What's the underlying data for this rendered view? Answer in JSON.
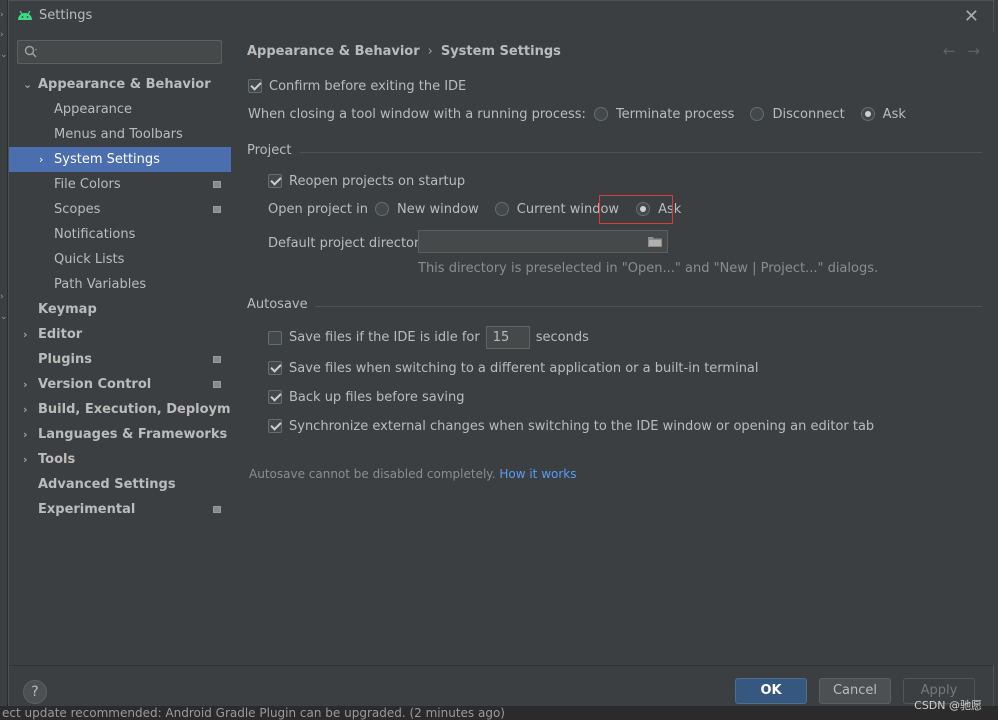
{
  "window": {
    "title": "Settings",
    "close_glyph": "✕"
  },
  "colors": {
    "selection": "#4b6eaf",
    "ok_button": "#365880",
    "link": "#589df6",
    "highlight_box": "#d83b3b"
  },
  "search": {
    "placeholder": "",
    "value": ""
  },
  "sidebar": {
    "items": [
      {
        "label": "Appearance & Behavior",
        "bold": true,
        "arrow": "⌄",
        "level": 0
      },
      {
        "label": "Appearance",
        "bold": false,
        "arrow": "",
        "level": 1
      },
      {
        "label": "Menus and Toolbars",
        "bold": false,
        "arrow": "",
        "level": 1
      },
      {
        "label": "System Settings",
        "bold": false,
        "arrow": "›",
        "level": 1,
        "selected": true
      },
      {
        "label": "File Colors",
        "bold": false,
        "arrow": "",
        "level": 1,
        "project_icon": true
      },
      {
        "label": "Scopes",
        "bold": false,
        "arrow": "",
        "level": 1,
        "project_icon": true
      },
      {
        "label": "Notifications",
        "bold": false,
        "arrow": "",
        "level": 1
      },
      {
        "label": "Quick Lists",
        "bold": false,
        "arrow": "",
        "level": 1
      },
      {
        "label": "Path Variables",
        "bold": false,
        "arrow": "",
        "level": 1
      },
      {
        "label": "Keymap",
        "bold": true,
        "arrow": "",
        "level": 0
      },
      {
        "label": "Editor",
        "bold": true,
        "arrow": "›",
        "level": 0
      },
      {
        "label": "Plugins",
        "bold": true,
        "arrow": "",
        "level": 0,
        "project_icon": true
      },
      {
        "label": "Version Control",
        "bold": true,
        "arrow": "›",
        "level": 0,
        "project_icon": true
      },
      {
        "label": "Build, Execution, Deployment",
        "bold": true,
        "arrow": "›",
        "level": 0
      },
      {
        "label": "Languages & Frameworks",
        "bold": true,
        "arrow": "›",
        "level": 0
      },
      {
        "label": "Tools",
        "bold": true,
        "arrow": "›",
        "level": 0
      },
      {
        "label": "Advanced Settings",
        "bold": true,
        "arrow": "",
        "level": 0
      },
      {
        "label": "Experimental",
        "bold": true,
        "arrow": "",
        "level": 0,
        "project_icon": true
      }
    ]
  },
  "breadcrumb": {
    "parent": "Appearance & Behavior",
    "separator": "›",
    "current": "System Settings"
  },
  "nav": {
    "back": "←",
    "forward": "→"
  },
  "general": {
    "confirm_exit": {
      "label": "Confirm before exiting the IDE",
      "checked": true
    },
    "closing_label": "When closing a tool window with a running process:",
    "closing_options": [
      {
        "label": "Terminate process",
        "selected": false
      },
      {
        "label": "Disconnect",
        "selected": false
      },
      {
        "label": "Ask",
        "selected": true
      }
    ]
  },
  "project": {
    "section_title": "Project",
    "reopen": {
      "label": "Reopen projects on startup",
      "checked": true
    },
    "open_in_label": "Open project in",
    "open_in_options": [
      {
        "label": "New window",
        "selected": false
      },
      {
        "label": "Current window",
        "selected": false
      },
      {
        "label": "Ask",
        "selected": true
      }
    ],
    "default_dir_label": "Default project directory:",
    "default_dir_value": "",
    "hint": "This directory is preselected in \"Open...\" and \"New | Project...\" dialogs."
  },
  "autosave": {
    "section_title": "Autosave",
    "idle": {
      "label_before": "Save files if the IDE is idle for",
      "value": "15",
      "label_after": "seconds",
      "checked": false
    },
    "switching": {
      "label": "Save files when switching to a different application or a built-in terminal",
      "checked": true
    },
    "backup": {
      "label": "Back up files before saving",
      "checked": true
    },
    "sync": {
      "label": "Synchronize external changes when switching to the IDE window or opening an editor tab",
      "checked": true
    },
    "note": "Autosave cannot be disabled completely.",
    "note_link": "How it works"
  },
  "footer": {
    "help": "?",
    "ok": "OK",
    "cancel": "Cancel",
    "apply": "Apply"
  },
  "status_bar": "ect update recommended: Android Gradle Plugin can be upgraded. (2 minutes ago)",
  "watermark": "CSDN @驰愿"
}
